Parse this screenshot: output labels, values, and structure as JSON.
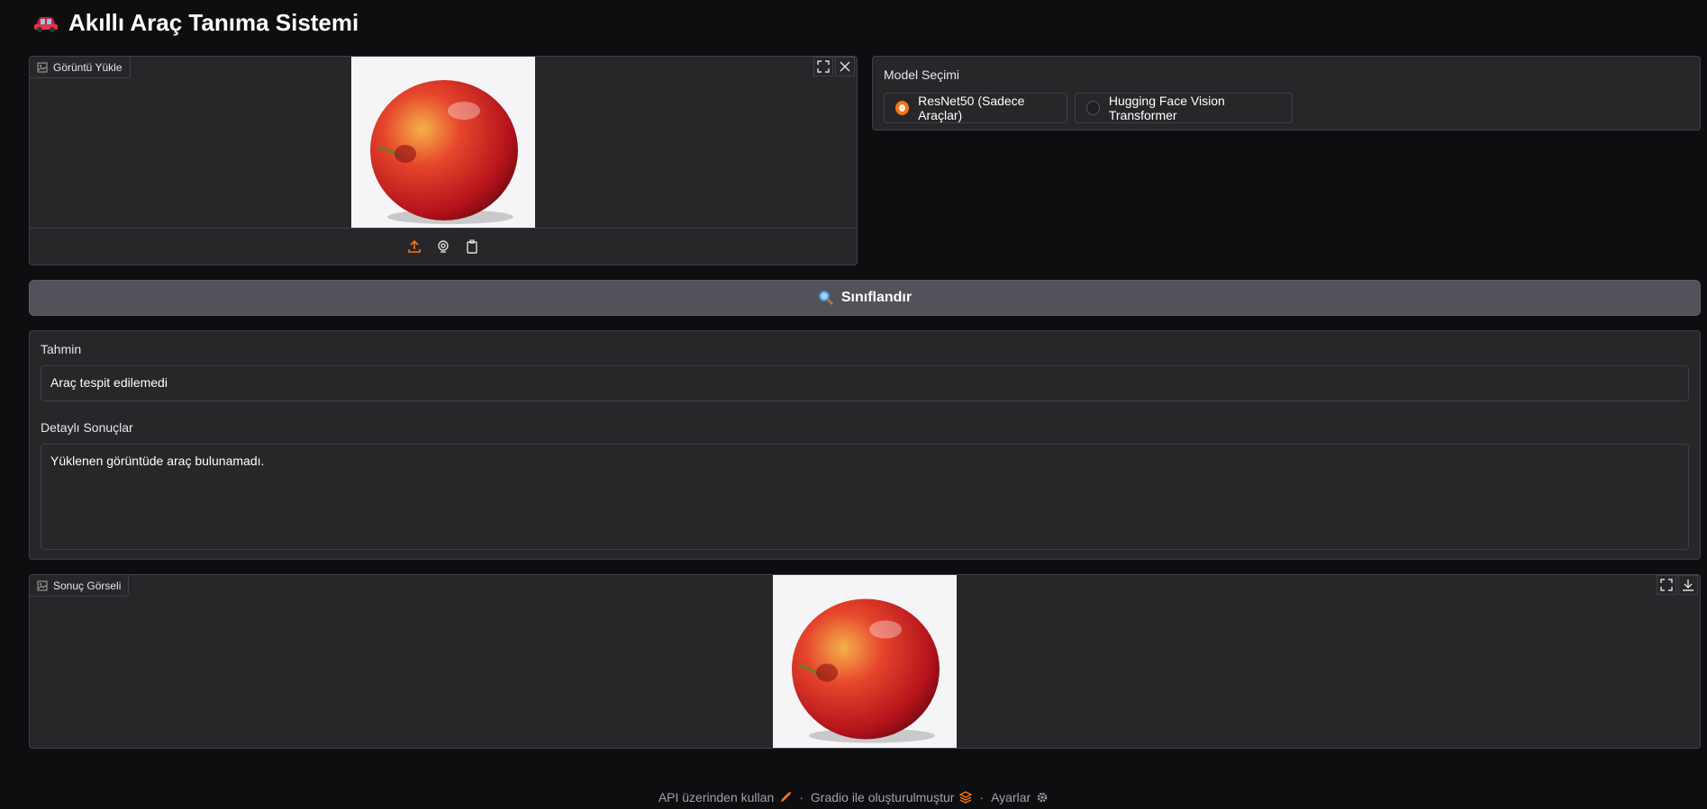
{
  "app": {
    "title": "Akıllı Araç Tanıma Sistemi"
  },
  "upload": {
    "label": "Görüntü Yükle",
    "sources": [
      "upload-icon",
      "webcam-icon",
      "clipboard-icon"
    ]
  },
  "model": {
    "label": "Model Seçimi",
    "options": [
      {
        "label": "ResNet50 (Sadece Araçlar)",
        "selected": true
      },
      {
        "label": "Hugging Face Vision Transformer",
        "selected": false
      }
    ]
  },
  "classify": {
    "label": "Sınıflandır"
  },
  "results": {
    "prediction_label": "Tahmin",
    "prediction_value": "Araç tespit edilemedi",
    "details_label": "Detaylı Sonuçlar",
    "details_value": "Yüklenen görüntüde araç bulunamadı."
  },
  "output_image": {
    "label": "Sonuç Görseli"
  },
  "footer": {
    "api": "API üzerinden kullan",
    "gradio": "Gradio ile oluşturulmuştur",
    "settings": "Ayarlar",
    "separator": "·"
  },
  "colors": {
    "accent": "#f97316",
    "background": "#0e0e11",
    "panel": "#27272a",
    "button": "#52525b"
  }
}
